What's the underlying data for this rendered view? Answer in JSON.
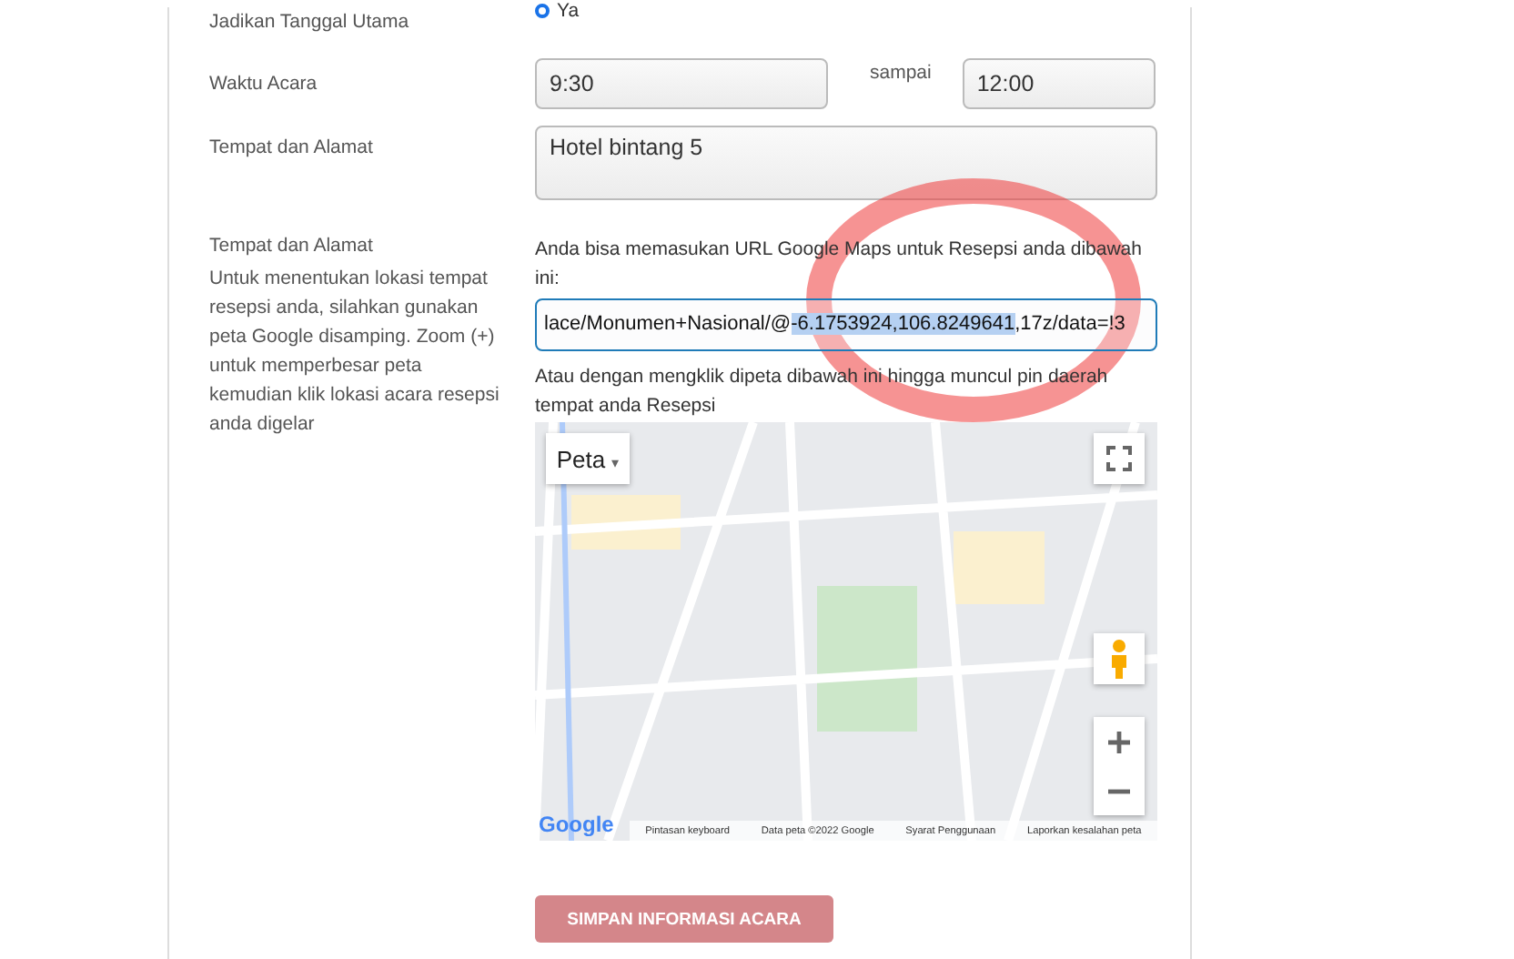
{
  "main_date": {
    "label": "Jadikan Tanggal Utama",
    "option": "Ya",
    "selected": true
  },
  "time": {
    "label": "Waktu Acara",
    "start": "9:30",
    "separator": "sampai",
    "end": "12:00"
  },
  "venue": {
    "label": "Tempat dan Alamat",
    "value": "Hotel bintang 5"
  },
  "location": {
    "label": "Tempat dan Alamat",
    "help": "Untuk menentukan lokasi tempat resepsi anda, silahkan gunakan peta Google disamping. Zoom (+) untuk memperbesar peta kemudian klik lokasi acara resepsi anda digelar",
    "intro": "Anda bisa memasukan URL Google Maps untuk Resepsi anda dibawah ini:",
    "url_parts": [
      {
        "text": "lace/Monumen+Nasional/@",
        "selected": false
      },
      {
        "text": "-6.1753924,106.8249641",
        "selected": true
      },
      {
        "text": ",17z/data=!3",
        "selected": false
      }
    ],
    "map_hint": "Atau dengan mengklik dipeta dibawah ini hingga muncul pin daerah tempat anda Resepsi",
    "map": {
      "type_button": "Peta",
      "type_caret": "▾",
      "logo": "Google",
      "footer": [
        "Pintasan keyboard",
        "Data peta ©2022 Google",
        "Syarat Penggunaan",
        "Laporkan kesalahan peta"
      ]
    }
  },
  "save_button": "SIMPAN INFORMASI ACARA"
}
